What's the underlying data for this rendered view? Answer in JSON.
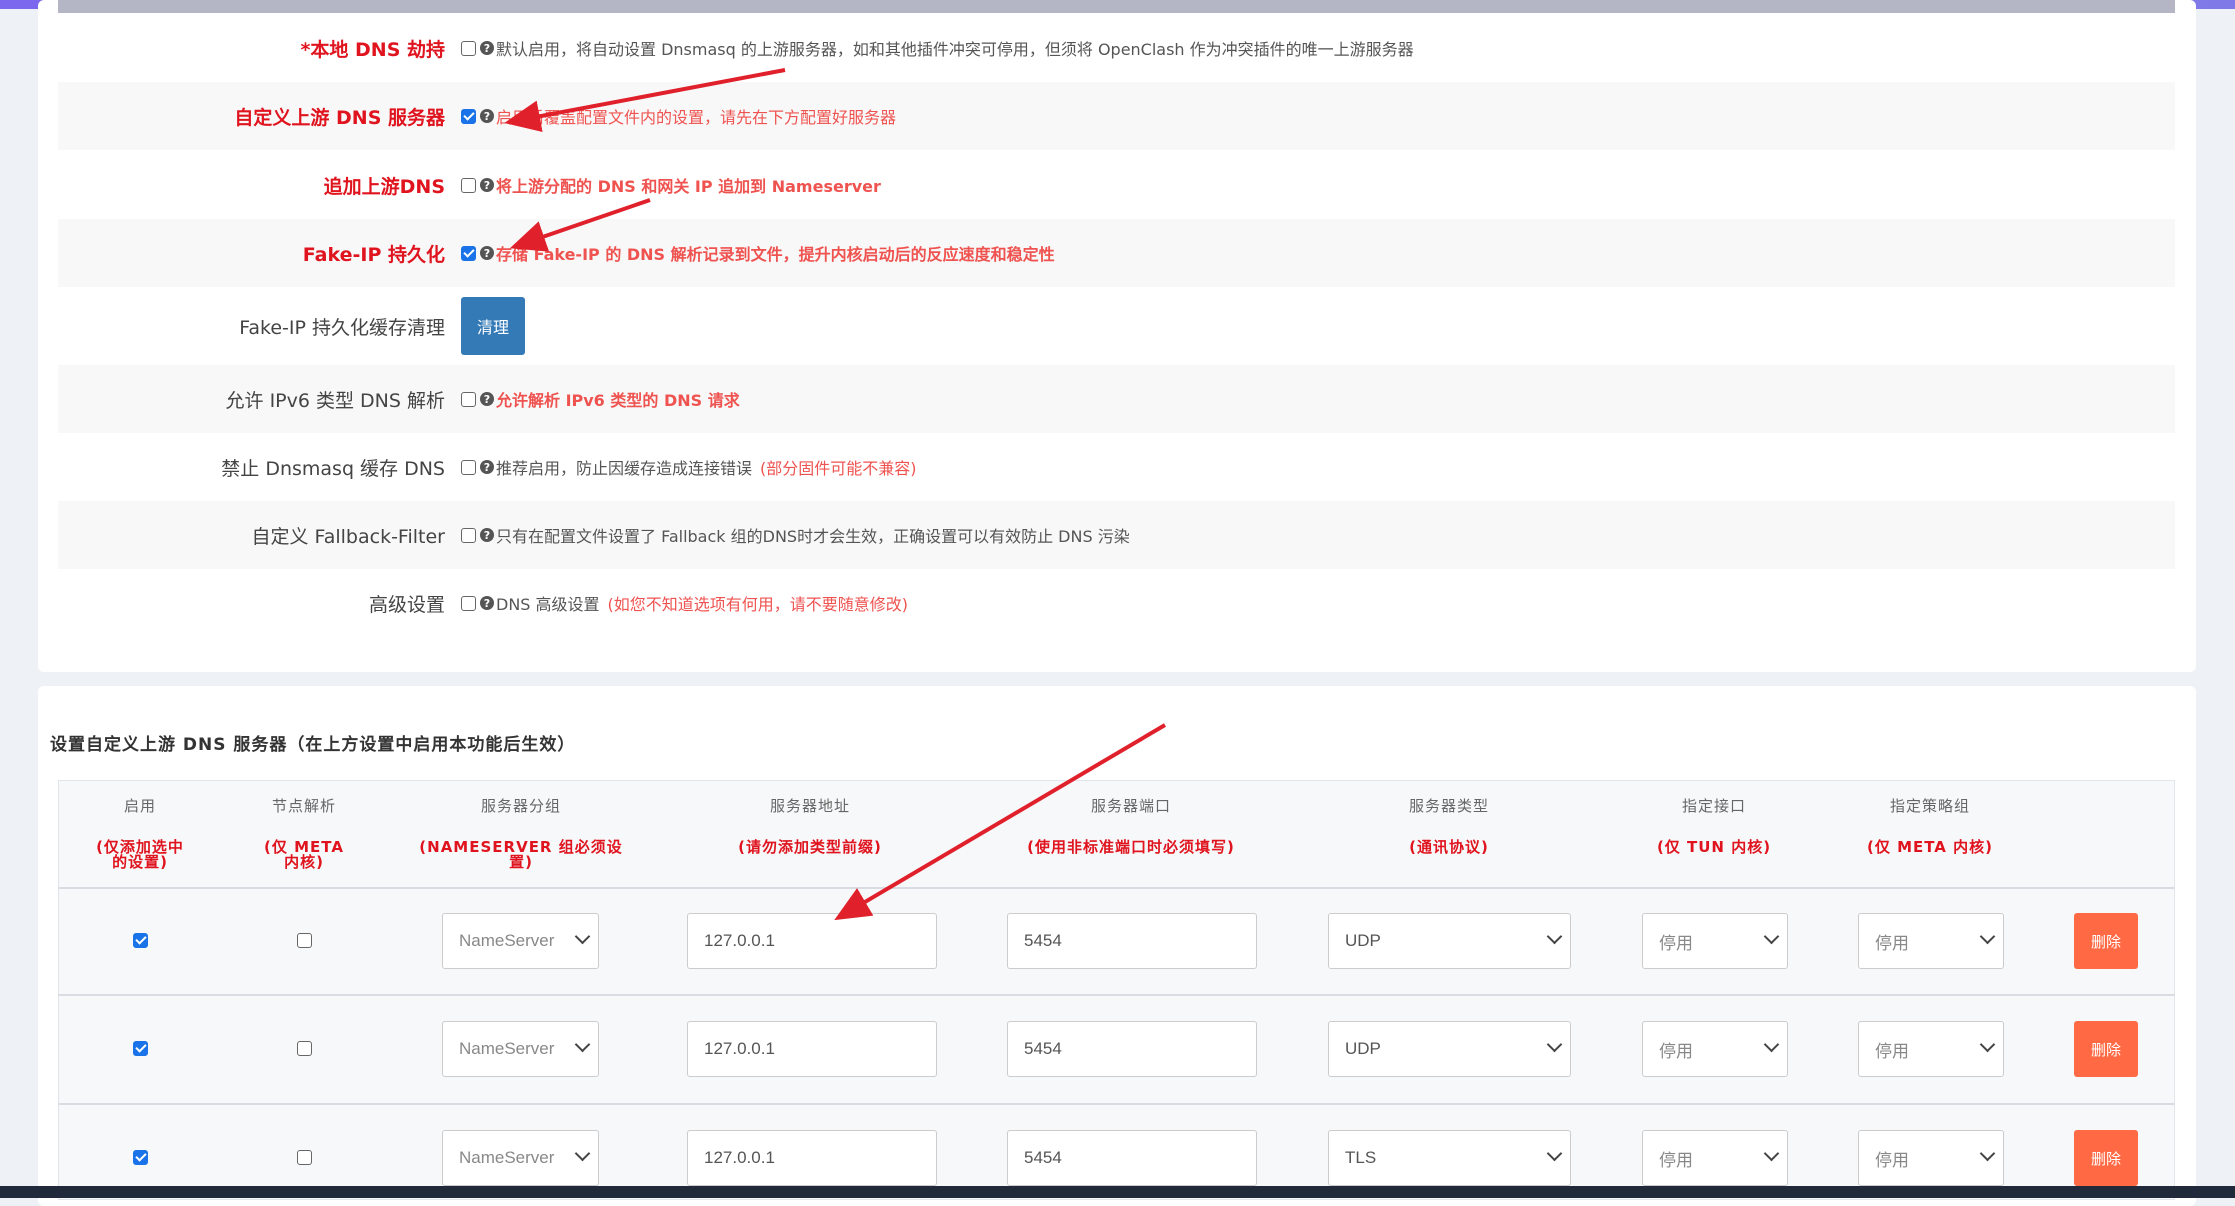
{
  "dns_settings": {
    "rows": [
      {
        "label": "*本地 DNS 劫持",
        "checked": false,
        "desc": "默认启用，将自动设置 Dnsmasq 的上游服务器，如和其他插件冲突可停用，但须将 OpenClash 作为冲突插件的唯一上游服务器"
      },
      {
        "label": "自定义上游 DNS 服务器",
        "checked": true,
        "desc": "启用后覆盖配置文件内的设置，请先在下方配置好服务器"
      },
      {
        "label": "追加上游DNS",
        "checked": false,
        "desc": "将上游分配的 DNS 和网关 IP 追加到 Nameserver"
      },
      {
        "label": "Fake-IP 持久化",
        "checked": true,
        "desc": "存储 Fake-IP 的 DNS 解析记录到文件，提升内核启动后的反应速度和稳定性"
      },
      {
        "label": "Fake-IP 持久化缓存清理",
        "button": "清理"
      },
      {
        "label": "允许 IPv6 类型 DNS 解析",
        "checked": false,
        "desc": "允许解析 IPv6 类型的 DNS 请求"
      },
      {
        "label": "禁止 Dnsmasq 缓存 DNS",
        "checked": false,
        "desc": "推荐启用，防止因缓存造成连接错误",
        "extra": "(部分固件可能不兼容)"
      },
      {
        "label": "自定义 Fallback-Filter",
        "checked": false,
        "desc": "只有在配置文件设置了 Fallback 组的DNS时才会生效，正确设置可以有效防止 DNS 污染"
      },
      {
        "label": "高级设置",
        "checked": false,
        "desc": "DNS 高级设置",
        "extra": "(如您不知道选项有何用，请不要随意修改)"
      }
    ]
  },
  "upstream": {
    "title": "设置自定义上游 DNS 服务器（在上方设置中启用本功能后生效）",
    "headers": [
      {
        "name": "启用",
        "sub": "(仅添加选中\n的设置)"
      },
      {
        "name": "节点解析",
        "sub": "(仅 META\n内核)"
      },
      {
        "name": "服务器分组",
        "sub": "(NAMESERVER 组必须设\n置)"
      },
      {
        "name": "服务器地址",
        "sub": "(请勿添加类型前缀)"
      },
      {
        "name": "服务器端口",
        "sub": "(使用非标准端口时必须填写)"
      },
      {
        "name": "服务器类型",
        "sub": "(通讯协议)"
      },
      {
        "name": "指定接口",
        "sub": "(仅 TUN 内核)"
      },
      {
        "name": "指定策略组",
        "sub": "(仅 META 内核)"
      }
    ],
    "rows": [
      {
        "enabled": true,
        "node_resolve": false,
        "group": "NameServer",
        "address": "127.0.0.1",
        "port": "5454",
        "type": "UDP",
        "interface": "停用",
        "policy": "停用",
        "delete": "删除"
      },
      {
        "enabled": true,
        "node_resolve": false,
        "group": "NameServer",
        "address": "127.0.0.1",
        "port": "5454",
        "type": "UDP",
        "interface": "停用",
        "policy": "停用",
        "delete": "删除"
      },
      {
        "enabled": true,
        "node_resolve": false,
        "group": "NameServer",
        "address": "127.0.0.1",
        "port": "5454",
        "type": "TLS",
        "interface": "停用",
        "policy": "停用",
        "delete": "删除"
      }
    ]
  },
  "colors": {
    "accent": "#337ab7",
    "danger": "#ff6a45",
    "highlight": "#e0141e",
    "annotation_arrow": "#e0202a"
  }
}
